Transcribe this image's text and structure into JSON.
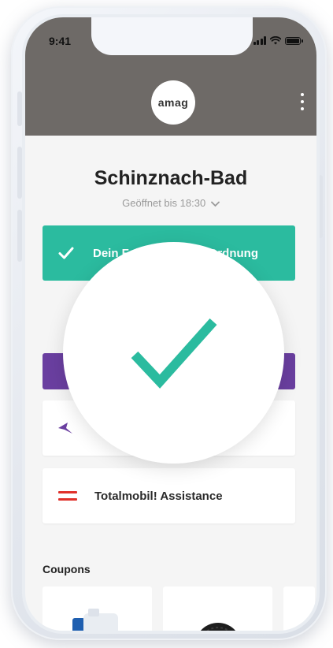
{
  "status_bar": {
    "time": "9:41"
  },
  "header": {
    "logo_text": "amag",
    "menu_icon": "kebab-menu-icon"
  },
  "location": {
    "name": "Schinznach-Bad",
    "hours": "Geöffnet bis 18:30"
  },
  "banner": {
    "text": "Dein Fahrzeug ist in Ordnung",
    "icon": "check-icon",
    "color": "#2bbb9f"
  },
  "cards": [
    {
      "label": "",
      "icon": "star-icon"
    },
    {
      "label": "Totalmobil! Assistance",
      "icon": "totalmobil-logo-icon"
    }
  ],
  "coupons": {
    "heading": "Coupons"
  },
  "overlay": {
    "icon": "large-check-icon",
    "color": "#2bbb9f"
  },
  "colors": {
    "header": "#6e6a67",
    "purple": "#6a3fa0",
    "accent_red": "#e0312b"
  }
}
